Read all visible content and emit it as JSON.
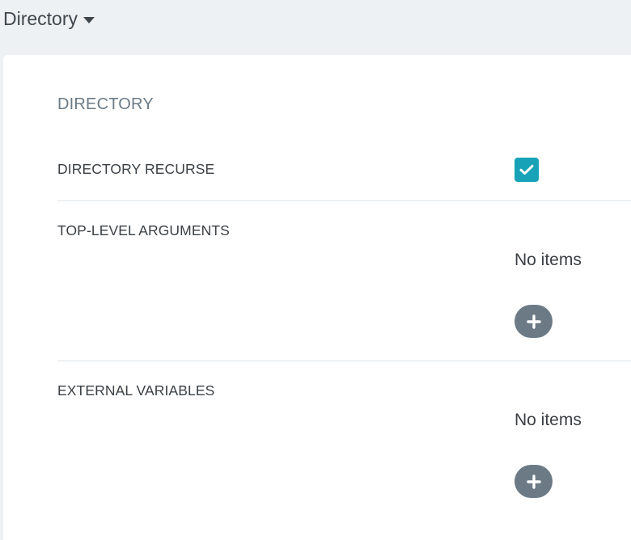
{
  "header": {
    "title": "Directory"
  },
  "section": {
    "title": "DIRECTORY"
  },
  "rows": {
    "recurse": {
      "label": "DIRECTORY RECURSE",
      "checked": true
    },
    "top_level_arguments": {
      "label": "TOP-LEVEL ARGUMENTS",
      "empty_text": "No items"
    },
    "external_variables": {
      "label": "EXTERNAL VARIABLES",
      "empty_text": "No items"
    }
  },
  "colors": {
    "accent": "#17a2b8",
    "add_button": "#6c7a86",
    "page_background": "#eef1f4"
  },
  "icons": {
    "caret": "caret-down-icon",
    "check": "check-icon",
    "add": "plus-icon"
  }
}
